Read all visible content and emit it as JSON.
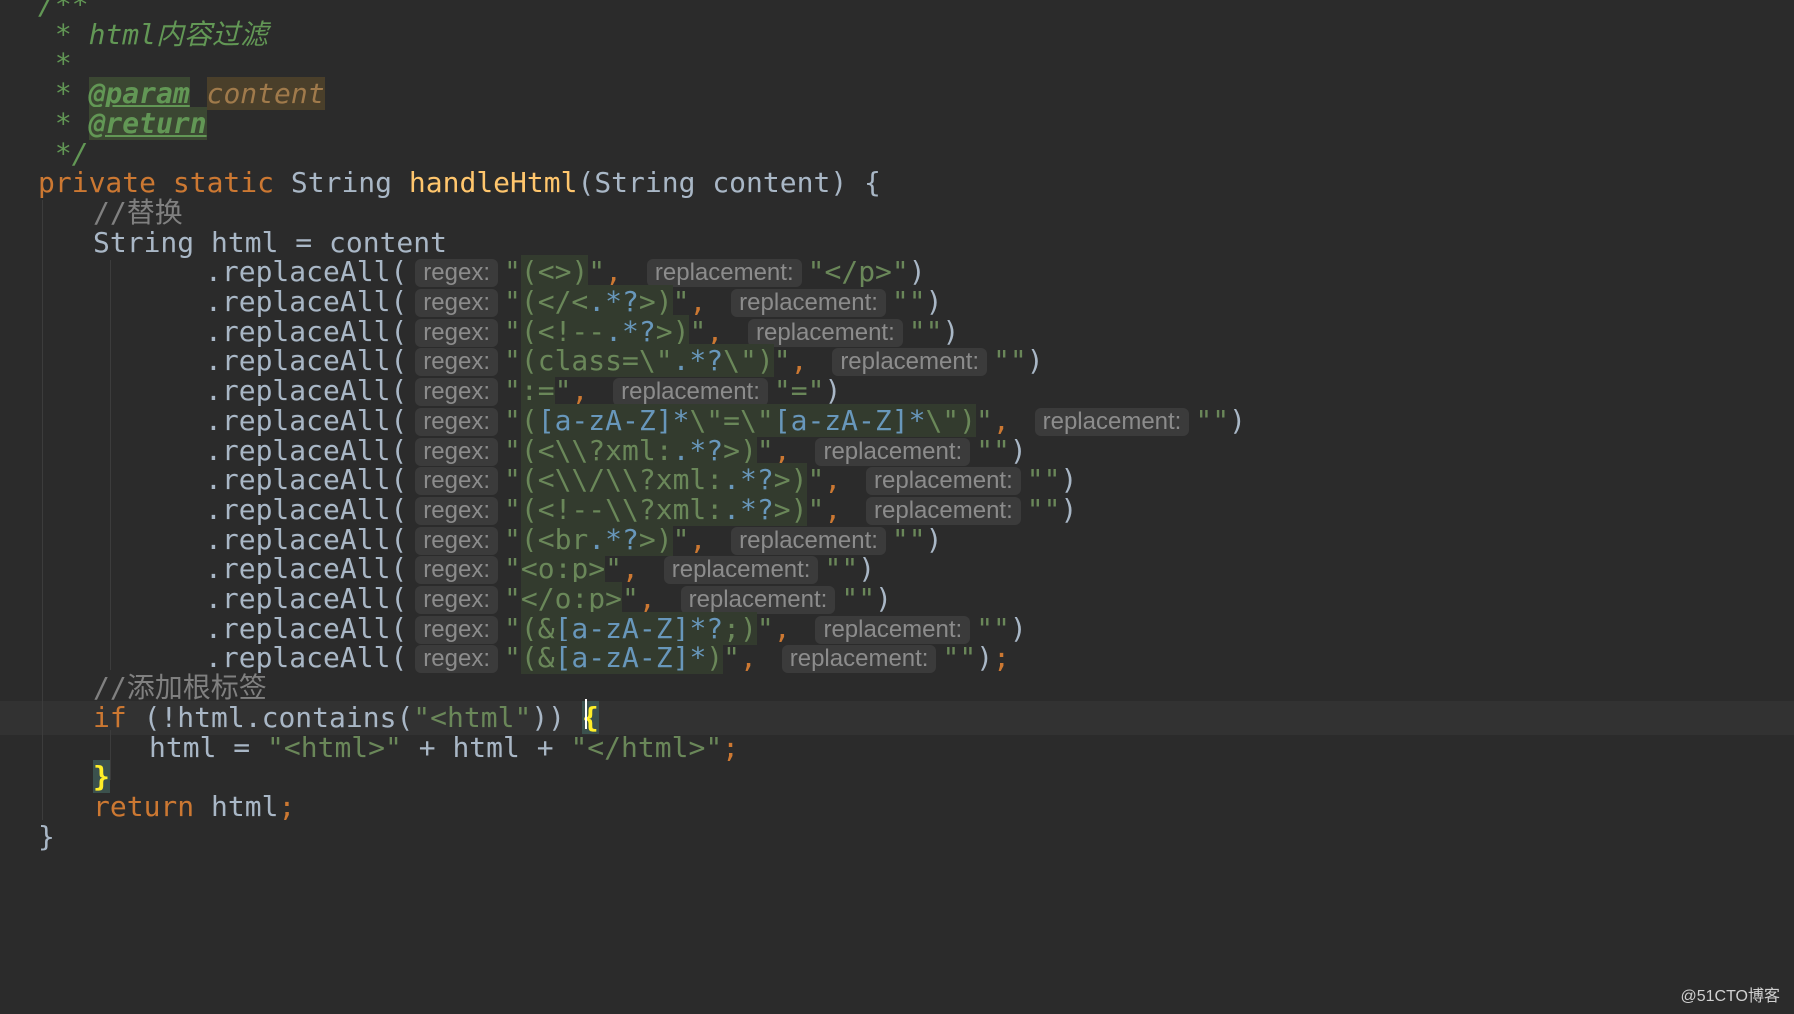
{
  "editor": {
    "lines": [
      {
        "indent": 0,
        "caret": false,
        "segments": [
          {
            "t": "t-doc",
            "text": "/**"
          }
        ]
      },
      {
        "indent": 0,
        "caret": false,
        "segments": [
          {
            "t": "t-doc",
            "text": " * html内容过滤"
          }
        ]
      },
      {
        "indent": 0,
        "caret": false,
        "segments": [
          {
            "t": "t-doc",
            "text": " *"
          }
        ]
      },
      {
        "indent": 0,
        "caret": false,
        "segments": [
          {
            "t": "t-doc",
            "text": " * "
          },
          {
            "t": "t-doctag",
            "text": "@param"
          },
          {
            "t": "t-doc",
            "text": " "
          },
          {
            "t": "t-param",
            "text": "content"
          }
        ]
      },
      {
        "indent": 0,
        "caret": false,
        "segments": [
          {
            "t": "t-doc",
            "text": " * "
          },
          {
            "t": "t-doctag",
            "text": "@return"
          }
        ]
      },
      {
        "indent": 0,
        "caret": false,
        "segments": [
          {
            "t": "t-doc",
            "text": " */"
          }
        ]
      },
      {
        "indent": 0,
        "caret": false,
        "segments": [
          {
            "t": "t-kw",
            "text": "private static "
          },
          {
            "t": "t-default",
            "text": "String "
          },
          {
            "t": "t-method",
            "text": "handleHtml"
          },
          {
            "t": "t-default",
            "text": "(String content) {"
          }
        ]
      },
      {
        "indent": 1,
        "caret": false,
        "segments": [
          {
            "t": "t-comment",
            "text": "//替换"
          }
        ]
      },
      {
        "indent": 1,
        "caret": false,
        "segments": [
          {
            "t": "t-default",
            "text": "String html = content"
          }
        ]
      },
      {
        "indent": 3,
        "caret": false,
        "segments": [
          {
            "t": "t-default",
            "text": ".replaceAll("
          },
          {
            "t": "hint",
            "text": "regex:"
          },
          {
            "t": "t-str",
            "text": "\""
          },
          {
            "t": "t-str-re",
            "text": "(<>)"
          },
          {
            "t": "t-str",
            "text": "\""
          },
          {
            "t": "t-punct",
            "text": ", "
          },
          {
            "t": "hint",
            "text": "replacement:"
          },
          {
            "t": "t-str",
            "text": "\"</p>\""
          },
          {
            "t": "t-default",
            "text": ")"
          }
        ]
      },
      {
        "indent": 3,
        "caret": false,
        "segments": [
          {
            "t": "t-default",
            "text": ".replaceAll("
          },
          {
            "t": "hint",
            "text": "regex:"
          },
          {
            "t": "t-str",
            "text": "\""
          },
          {
            "t": "t-str-re",
            "text": "(</<"
          },
          {
            "t": "t-re-meta",
            "text": ".*?"
          },
          {
            "t": "t-str-re",
            "text": ">)"
          },
          {
            "t": "t-str",
            "text": "\""
          },
          {
            "t": "t-punct",
            "text": ", "
          },
          {
            "t": "hint",
            "text": "replacement:"
          },
          {
            "t": "t-str",
            "text": "\"\""
          },
          {
            "t": "t-default",
            "text": ")"
          }
        ]
      },
      {
        "indent": 3,
        "caret": false,
        "segments": [
          {
            "t": "t-default",
            "text": ".replaceAll("
          },
          {
            "t": "hint",
            "text": "regex:"
          },
          {
            "t": "t-str",
            "text": "\""
          },
          {
            "t": "t-str-re",
            "text": "(<!--"
          },
          {
            "t": "t-re-meta",
            "text": ".*?"
          },
          {
            "t": "t-str-re",
            "text": ">)"
          },
          {
            "t": "t-str",
            "text": "\""
          },
          {
            "t": "t-punct",
            "text": ", "
          },
          {
            "t": "hint",
            "text": "replacement:"
          },
          {
            "t": "t-str",
            "text": "\"\""
          },
          {
            "t": "t-default",
            "text": ")"
          }
        ]
      },
      {
        "indent": 3,
        "caret": false,
        "segments": [
          {
            "t": "t-default",
            "text": ".replaceAll("
          },
          {
            "t": "hint",
            "text": "regex:"
          },
          {
            "t": "t-str",
            "text": "\""
          },
          {
            "t": "t-str-re",
            "text": "(class=\\\""
          },
          {
            "t": "t-re-meta",
            "text": ".*?"
          },
          {
            "t": "t-str-re",
            "text": "\\\")"
          },
          {
            "t": "t-str",
            "text": "\""
          },
          {
            "t": "t-punct",
            "text": ", "
          },
          {
            "t": "hint",
            "text": "replacement:"
          },
          {
            "t": "t-str",
            "text": "\"\""
          },
          {
            "t": "t-default",
            "text": ")"
          }
        ]
      },
      {
        "indent": 3,
        "caret": false,
        "segments": [
          {
            "t": "t-default",
            "text": ".replaceAll("
          },
          {
            "t": "hint",
            "text": "regex:"
          },
          {
            "t": "t-str",
            "text": "\""
          },
          {
            "t": "t-str-re",
            "text": ":="
          },
          {
            "t": "t-str",
            "text": "\""
          },
          {
            "t": "t-punct",
            "text": ", "
          },
          {
            "t": "hint",
            "text": "replacement:"
          },
          {
            "t": "t-str",
            "text": "\"=\""
          },
          {
            "t": "t-default",
            "text": ")"
          }
        ]
      },
      {
        "indent": 3,
        "caret": false,
        "segments": [
          {
            "t": "t-default",
            "text": ".replaceAll("
          },
          {
            "t": "hint",
            "text": "regex:"
          },
          {
            "t": "t-str",
            "text": "\""
          },
          {
            "t": "t-str-re",
            "text": "("
          },
          {
            "t": "t-re-meta",
            "text": "[a-zA-Z]*"
          },
          {
            "t": "t-str-re",
            "text": "\\\"=\\\""
          },
          {
            "t": "t-re-meta",
            "text": "[a-zA-Z]*"
          },
          {
            "t": "t-str-re",
            "text": "\\\")"
          },
          {
            "t": "t-str",
            "text": "\""
          },
          {
            "t": "t-punct",
            "text": ", "
          },
          {
            "t": "hint",
            "text": "replacement:"
          },
          {
            "t": "t-str",
            "text": "\"\""
          },
          {
            "t": "t-default",
            "text": ")"
          }
        ]
      },
      {
        "indent": 3,
        "caret": false,
        "segments": [
          {
            "t": "t-default",
            "text": ".replaceAll("
          },
          {
            "t": "hint",
            "text": "regex:"
          },
          {
            "t": "t-str",
            "text": "\""
          },
          {
            "t": "t-str-re",
            "text": "(<\\\\?xml:"
          },
          {
            "t": "t-re-meta",
            "text": ".*?"
          },
          {
            "t": "t-str-re",
            "text": ">)"
          },
          {
            "t": "t-str",
            "text": "\""
          },
          {
            "t": "t-punct",
            "text": ", "
          },
          {
            "t": "hint",
            "text": "replacement:"
          },
          {
            "t": "t-str",
            "text": "\"\""
          },
          {
            "t": "t-default",
            "text": ")"
          }
        ]
      },
      {
        "indent": 3,
        "caret": false,
        "segments": [
          {
            "t": "t-default",
            "text": ".replaceAll("
          },
          {
            "t": "hint",
            "text": "regex:"
          },
          {
            "t": "t-str",
            "text": "\""
          },
          {
            "t": "t-str-re",
            "text": "(<\\\\/\\\\?xml:"
          },
          {
            "t": "t-re-meta",
            "text": ".*?"
          },
          {
            "t": "t-str-re",
            "text": ">)"
          },
          {
            "t": "t-str",
            "text": "\""
          },
          {
            "t": "t-punct",
            "text": ", "
          },
          {
            "t": "hint",
            "text": "replacement:"
          },
          {
            "t": "t-str",
            "text": "\"\""
          },
          {
            "t": "t-default",
            "text": ")"
          }
        ]
      },
      {
        "indent": 3,
        "caret": false,
        "segments": [
          {
            "t": "t-default",
            "text": ".replaceAll("
          },
          {
            "t": "hint",
            "text": "regex:"
          },
          {
            "t": "t-str",
            "text": "\""
          },
          {
            "t": "t-str-re",
            "text": "(<!--\\\\?xml:"
          },
          {
            "t": "t-re-meta",
            "text": ".*?"
          },
          {
            "t": "t-str-re",
            "text": ">)"
          },
          {
            "t": "t-str",
            "text": "\""
          },
          {
            "t": "t-punct",
            "text": ", "
          },
          {
            "t": "hint",
            "text": "replacement:"
          },
          {
            "t": "t-str",
            "text": "\"\""
          },
          {
            "t": "t-default",
            "text": ")"
          }
        ]
      },
      {
        "indent": 3,
        "caret": false,
        "segments": [
          {
            "t": "t-default",
            "text": ".replaceAll("
          },
          {
            "t": "hint",
            "text": "regex:"
          },
          {
            "t": "t-str",
            "text": "\""
          },
          {
            "t": "t-str-re",
            "text": "(<br"
          },
          {
            "t": "t-re-meta",
            "text": ".*?"
          },
          {
            "t": "t-str-re",
            "text": ">)"
          },
          {
            "t": "t-str",
            "text": "\""
          },
          {
            "t": "t-punct",
            "text": ", "
          },
          {
            "t": "hint",
            "text": "replacement:"
          },
          {
            "t": "t-str",
            "text": "\"\""
          },
          {
            "t": "t-default",
            "text": ")"
          }
        ]
      },
      {
        "indent": 3,
        "caret": false,
        "segments": [
          {
            "t": "t-default",
            "text": ".replaceAll("
          },
          {
            "t": "hint",
            "text": "regex:"
          },
          {
            "t": "t-str",
            "text": "\""
          },
          {
            "t": "t-str-re",
            "text": "<o:p>"
          },
          {
            "t": "t-str",
            "text": "\""
          },
          {
            "t": "t-punct",
            "text": ", "
          },
          {
            "t": "hint",
            "text": "replacement:"
          },
          {
            "t": "t-str",
            "text": "\"\""
          },
          {
            "t": "t-default",
            "text": ")"
          }
        ]
      },
      {
        "indent": 3,
        "caret": false,
        "segments": [
          {
            "t": "t-default",
            "text": ".replaceAll("
          },
          {
            "t": "hint",
            "text": "regex:"
          },
          {
            "t": "t-str",
            "text": "\""
          },
          {
            "t": "t-str-re",
            "text": "</o:p>"
          },
          {
            "t": "t-str",
            "text": "\""
          },
          {
            "t": "t-punct",
            "text": ", "
          },
          {
            "t": "hint",
            "text": "replacement:"
          },
          {
            "t": "t-str",
            "text": "\"\""
          },
          {
            "t": "t-default",
            "text": ")"
          }
        ]
      },
      {
        "indent": 3,
        "caret": false,
        "segments": [
          {
            "t": "t-default",
            "text": ".replaceAll("
          },
          {
            "t": "hint",
            "text": "regex:"
          },
          {
            "t": "t-str",
            "text": "\""
          },
          {
            "t": "t-str-re",
            "text": "(&"
          },
          {
            "t": "t-re-meta",
            "text": "[a-zA-Z]*?"
          },
          {
            "t": "t-str-re",
            "text": ";)"
          },
          {
            "t": "t-str",
            "text": "\""
          },
          {
            "t": "t-punct",
            "text": ", "
          },
          {
            "t": "hint",
            "text": "replacement:"
          },
          {
            "t": "t-str",
            "text": "\"\""
          },
          {
            "t": "t-default",
            "text": ")"
          }
        ]
      },
      {
        "indent": 3,
        "caret": false,
        "segments": [
          {
            "t": "t-default",
            "text": ".replaceAll("
          },
          {
            "t": "hint",
            "text": "regex:"
          },
          {
            "t": "t-str",
            "text": "\""
          },
          {
            "t": "t-str-re",
            "text": "(&"
          },
          {
            "t": "t-re-meta",
            "text": "[a-zA-Z]*"
          },
          {
            "t": "t-str-re",
            "text": ")"
          },
          {
            "t": "t-str",
            "text": "\""
          },
          {
            "t": "t-punct",
            "text": ", "
          },
          {
            "t": "hint",
            "text": "replacement:"
          },
          {
            "t": "t-str",
            "text": "\"\""
          },
          {
            "t": "t-default",
            "text": ")"
          },
          {
            "t": "t-punct",
            "text": ";"
          }
        ]
      },
      {
        "indent": 1,
        "caret": false,
        "segments": [
          {
            "t": "t-comment",
            "text": "//添加根标签"
          }
        ]
      },
      {
        "indent": 1,
        "caret": true,
        "segments": [
          {
            "t": "t-kw",
            "text": "if "
          },
          {
            "t": "t-default",
            "text": "(!html.contains("
          },
          {
            "t": "t-str",
            "text": "\"<html\""
          },
          {
            "t": "t-default",
            "text": ")) "
          },
          {
            "t": "t-brace-hl",
            "text": "{"
          }
        ]
      },
      {
        "indent": 2,
        "caret": false,
        "segments": [
          {
            "t": "t-default",
            "text": "html = "
          },
          {
            "t": "t-str",
            "text": "\"<html>\""
          },
          {
            "t": "t-default",
            "text": " + html + "
          },
          {
            "t": "t-str",
            "text": "\"</html>\""
          },
          {
            "t": "t-punct",
            "text": ";"
          }
        ]
      },
      {
        "indent": 1,
        "caret": false,
        "segments": [
          {
            "t": "t-brace-hl",
            "text": "}"
          }
        ]
      },
      {
        "indent": 1,
        "caret": false,
        "segments": [
          {
            "t": "t-kw",
            "text": "return "
          },
          {
            "t": "t-default",
            "text": "html"
          },
          {
            "t": "t-punct",
            "text": ";"
          }
        ]
      },
      {
        "indent": 0,
        "caret": false,
        "segments": [
          {
            "t": "t-default",
            "text": "}"
          }
        ]
      }
    ]
  },
  "watermark": "@51CTO博客"
}
